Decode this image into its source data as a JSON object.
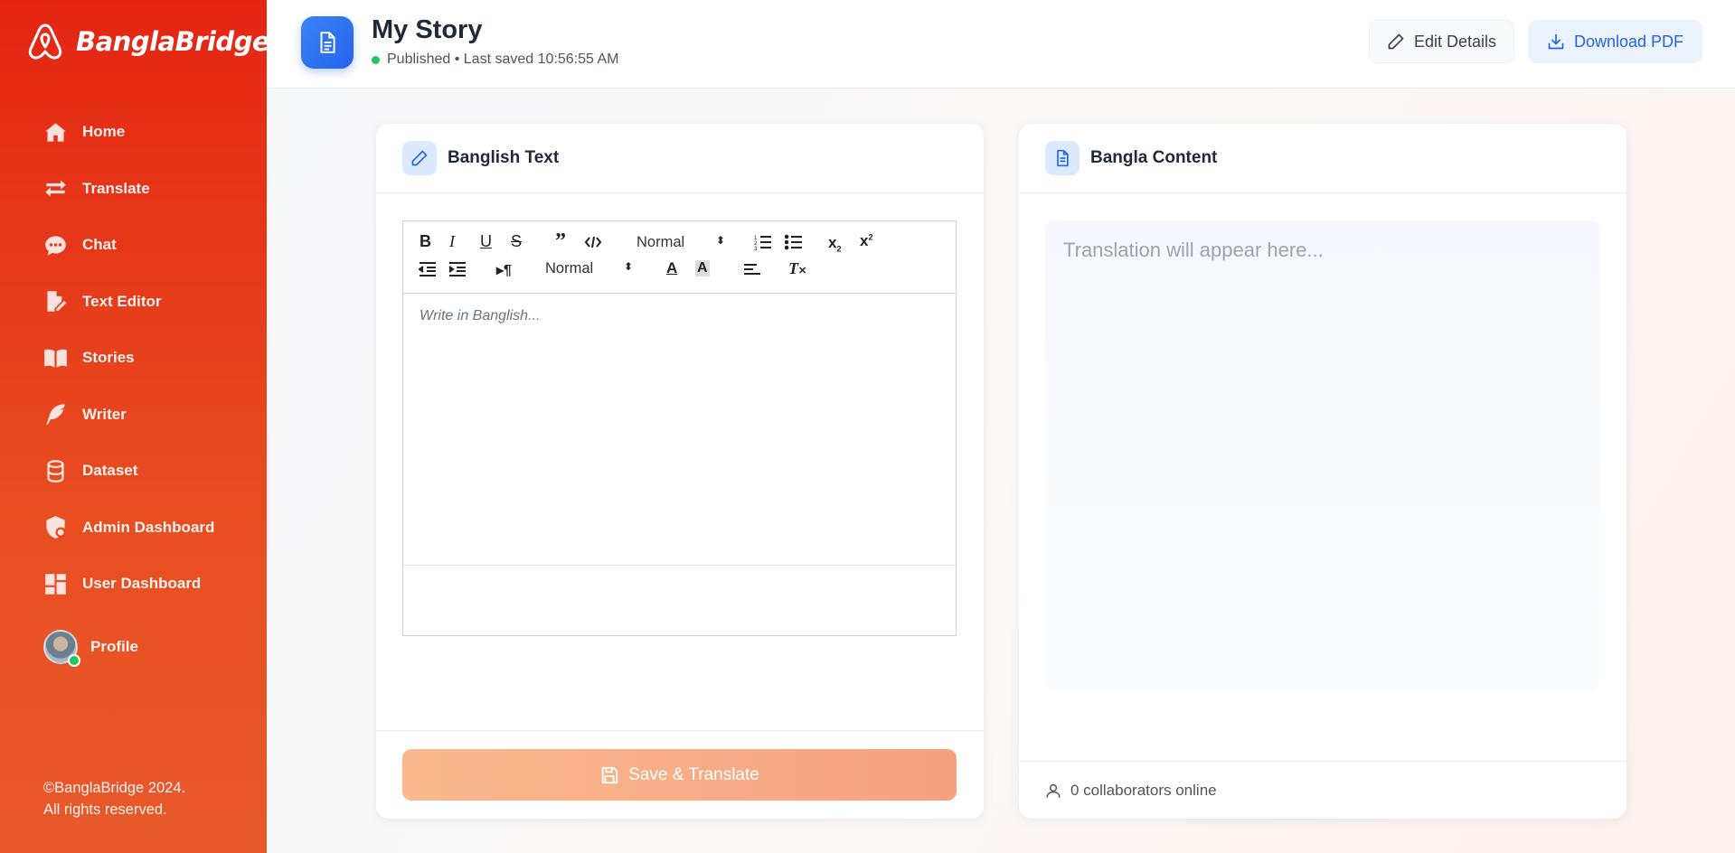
{
  "brand": {
    "name": "BanglaBridge"
  },
  "sidebar": {
    "items": [
      {
        "label": "Home",
        "icon": "home-icon"
      },
      {
        "label": "Translate",
        "icon": "arrows-swap-icon"
      },
      {
        "label": "Chat",
        "icon": "chat-bubble-icon"
      },
      {
        "label": "Text Editor",
        "icon": "file-pen-icon"
      },
      {
        "label": "Stories",
        "icon": "book-open-icon"
      },
      {
        "label": "Writer",
        "icon": "feather-icon"
      },
      {
        "label": "Dataset",
        "icon": "database-icon"
      },
      {
        "label": "Admin Dashboard",
        "icon": "shield-user-icon"
      },
      {
        "label": "User Dashboard",
        "icon": "dashboard-grid-icon"
      }
    ],
    "profile_label": "Profile",
    "copyright_line1": "©BanglaBridge 2024.",
    "copyright_line2": "All rights reserved."
  },
  "header": {
    "title": "My Story",
    "status": "Published • Last saved 10:56:55 AM",
    "edit_label": "Edit Details",
    "download_label": "Download PDF"
  },
  "left_card": {
    "title": "Banglish Text",
    "toolbar": {
      "header_select": "Normal",
      "size_select": "Normal"
    },
    "editor_placeholder": "Write in Banglish...",
    "save_label": "Save & Translate"
  },
  "right_card": {
    "title": "Bangla Content",
    "placeholder": "Translation will appear here...",
    "collaborators": "0 collaborators online"
  },
  "colors": {
    "sidebar_top": "#e42513",
    "sidebar_bottom": "#e85a2c",
    "accent_blue": "#2563eb",
    "online_green": "#22c55e",
    "save_button": "#fbb98e"
  }
}
